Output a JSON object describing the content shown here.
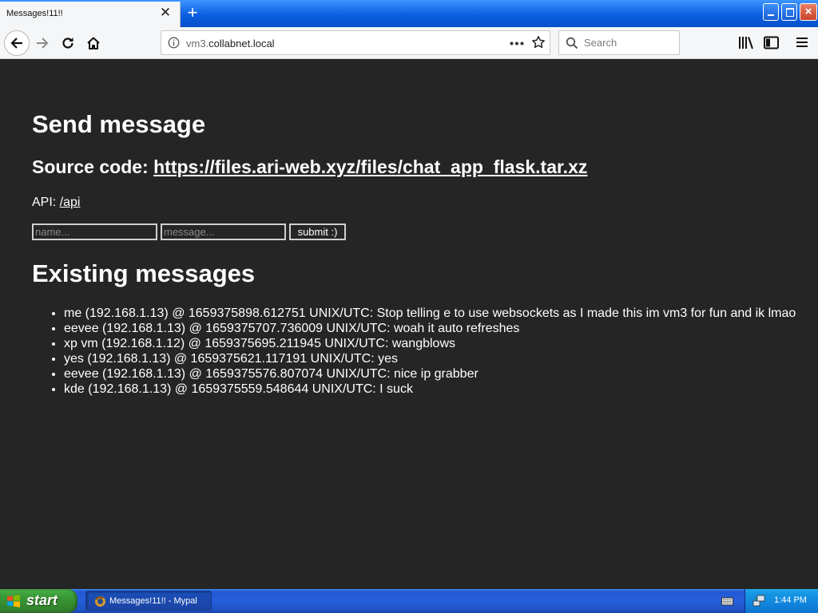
{
  "browser": {
    "tab_title": "Messages!11!!",
    "tab_close_label": "✕",
    "new_tab_label": "+",
    "url_host_prefix": "vm3.",
    "url_domain": "collabnet.local",
    "search_placeholder": "Search"
  },
  "page": {
    "send_heading": "Send message",
    "source_prefix": "Source code: ",
    "source_link": "https://files.ari-web.xyz/files/chat_app_flask.tar.xz",
    "api_prefix": "API: ",
    "api_link": "/api",
    "name_placeholder": "name...",
    "message_placeholder": "message...",
    "submit_label": "submit :)",
    "existing_heading": "Existing messages",
    "messages": [
      "me (192.168.1.13) @ 1659375898.612751 UNIX/UTC: Stop telling e to use websockets as I made this im vm3 for fun and ik lmao",
      "eevee (192.168.1.13) @ 1659375707.736009 UNIX/UTC: woah it auto refreshes",
      "xp vm (192.168.1.12) @ 1659375695.211945 UNIX/UTC: wangblows",
      "yes (192.168.1.13) @ 1659375621.117191 UNIX/UTC: yes",
      "eevee (192.168.1.13) @ 1659375576.807074 UNIX/UTC: nice ip grabber",
      "kde (192.168.1.13) @ 1659375559.548644 UNIX/UTC: I suck"
    ]
  },
  "taskbar": {
    "start_label": "start",
    "task_label": "Messages!11!! - Mypal",
    "clock": "1:44 PM"
  },
  "colors": {
    "page_background": "#252525",
    "page_text": "#ffffff",
    "titlebar_blue": "#0a5fe0",
    "start_green": "#3a9a37"
  },
  "icons": {
    "back": "arrow-left-icon",
    "forward": "arrow-right-icon",
    "reload": "reload-icon",
    "home": "home-icon",
    "info": "info-icon",
    "page_actions": "ellipsis-icon",
    "bookmark": "star-icon",
    "search": "search-icon",
    "library": "library-icon",
    "sidebar": "sidebar-icon",
    "menu": "hamburger-menu-icon"
  }
}
